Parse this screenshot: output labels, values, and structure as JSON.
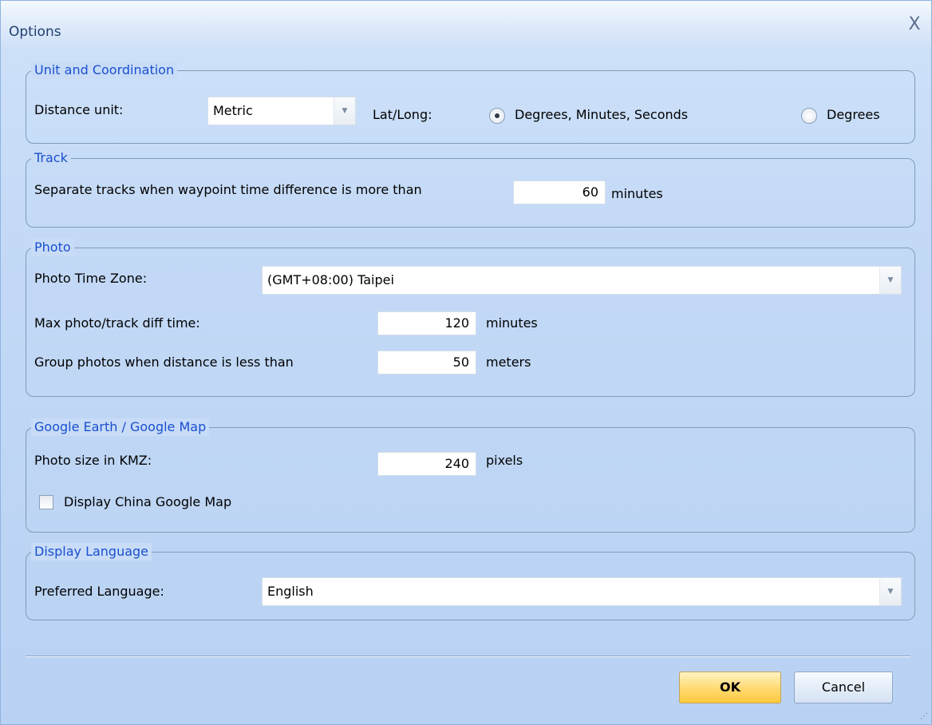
{
  "window": {
    "title": "Options",
    "close_label": "X"
  },
  "unit_group": {
    "legend": "Unit and Coordination",
    "distance_label": "Distance unit:",
    "distance_value": "Metric",
    "latlong_label": "Lat/Long:",
    "radio_dms_label": "Degrees, Minutes, Seconds",
    "radio_degrees_label": "Degrees",
    "selected": "dms"
  },
  "track_group": {
    "legend": "Track",
    "separate_label": "Separate tracks when waypoint time difference is more than",
    "separate_value": "60",
    "separate_unit": "minutes"
  },
  "photo_group": {
    "legend": "Photo",
    "timezone_label": "Photo Time Zone:",
    "timezone_value": "(GMT+08:00) Taipei",
    "maxdiff_label": "Max photo/track diff time:",
    "maxdiff_value": "120",
    "maxdiff_unit": "minutes",
    "group_label": "Group photos when distance is less than",
    "group_value": "50",
    "group_unit": "meters"
  },
  "google_group": {
    "legend": "Google Earth / Google Map",
    "kmz_label": "Photo size in KMZ:",
    "kmz_value": "240",
    "kmz_unit": "pixels",
    "china_label": "Display China Google Map",
    "china_checked": false
  },
  "language_group": {
    "legend": "Display Language",
    "lang_label": "Preferred Language:",
    "lang_value": "English"
  },
  "buttons": {
    "ok": "OK",
    "cancel": "Cancel"
  },
  "icons": {
    "dropdown": "chevron-down-icon",
    "close": "close-icon",
    "grip": "resize-grip-icon"
  }
}
